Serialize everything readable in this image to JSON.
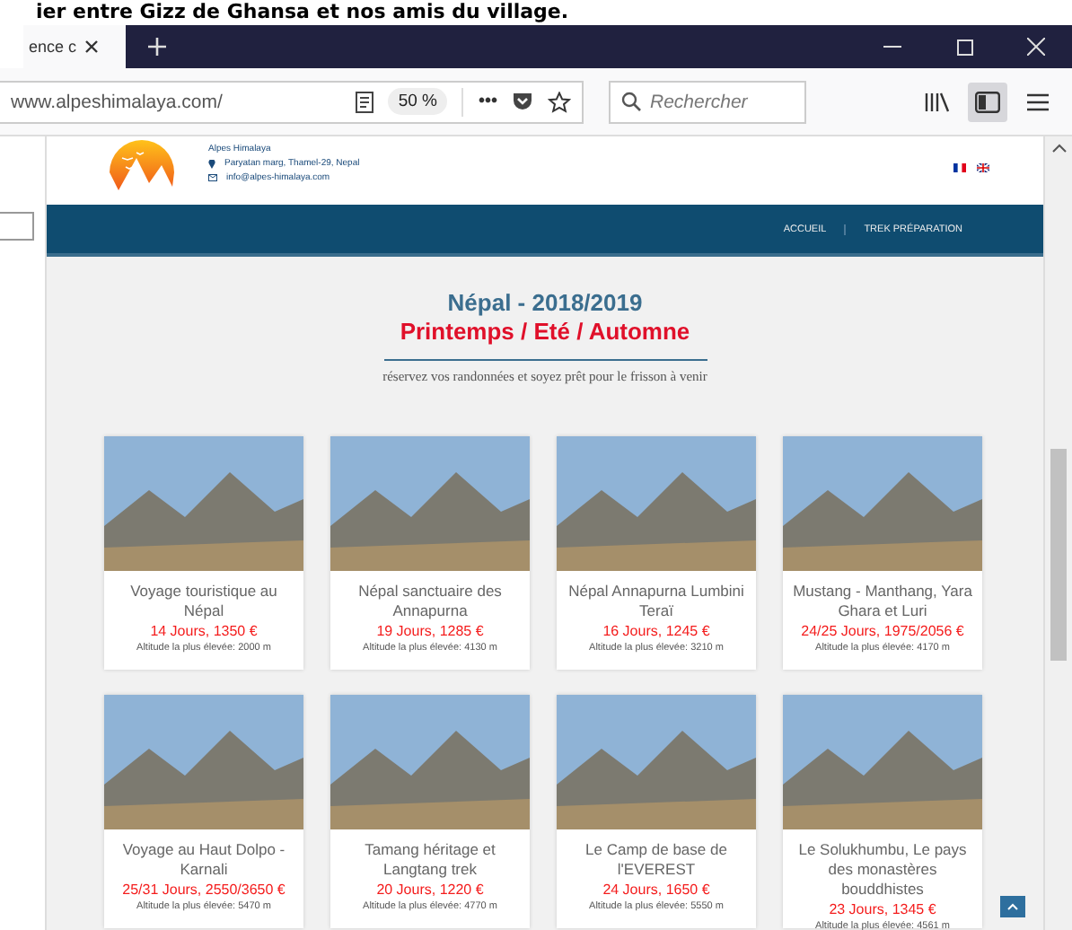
{
  "caption": "ier entre Gizz de Ghansa et nos amis du village.",
  "browser": {
    "tab_title": "ence c",
    "url": "www.alpeshimalaya.com/",
    "zoom": "50 %",
    "more": "•••",
    "search_placeholder": "Rechercher",
    "sidebar_active": true
  },
  "site": {
    "brand": "Alpes Himalaya",
    "address": "Paryatan marg, Thamel-29, Nepal",
    "email": "info@alpes-himalaya.com",
    "languages": [
      {
        "kind": "fr"
      },
      {
        "kind": "en"
      }
    ],
    "nav": [
      {
        "label": "ACCUEIL"
      },
      {
        "label": "TREK PRÉPARATION"
      }
    ],
    "title": "Népal - 2018/2019",
    "subtitle": "Printemps / Eté / Automne",
    "tagline": "réservez vos randonnées et soyez prêt pour le frisson à venir",
    "trips": [
      {
        "title": "Voyage touristique au Népal",
        "price": "14 Jours, 1350 €",
        "altitude": "Altitude la plus élevée: 2000 m"
      },
      {
        "title": "Népal sanctuaire des Annapurna",
        "price": "19 Jours, 1285 €",
        "altitude": "Altitude la plus élevée: 4130 m"
      },
      {
        "title": "Népal Annapurna Lumbini Teraï",
        "price": "16 Jours, 1245 €",
        "altitude": "Altitude la plus élevée: 3210 m"
      },
      {
        "title": "Mustang - Manthang, Yara Ghara et Luri",
        "price": "24/25 Jours, 1975/2056 €",
        "altitude": "Altitude la plus élevée: 4170 m"
      },
      {
        "title": "Voyage au Haut Dolpo - Karnali",
        "price": "25/31 Jours, 2550/3650 €",
        "altitude": "Altitude la plus élevée: 5470 m"
      },
      {
        "title": "Tamang héritage et Langtang trek",
        "price": "20 Jours, 1220 €",
        "altitude": "Altitude la plus élevée: 4770 m"
      },
      {
        "title": "Le Camp de base de l'EVEREST",
        "price": "24 Jours, 1650 €",
        "altitude": "Altitude la plus élevée: 5550 m"
      },
      {
        "title": "Le Solukhumbu, Le pays des monastères bouddhistes",
        "price": "23 Jours, 1345 €",
        "altitude": "Altitude la plus élevée: 4561 m"
      }
    ]
  }
}
